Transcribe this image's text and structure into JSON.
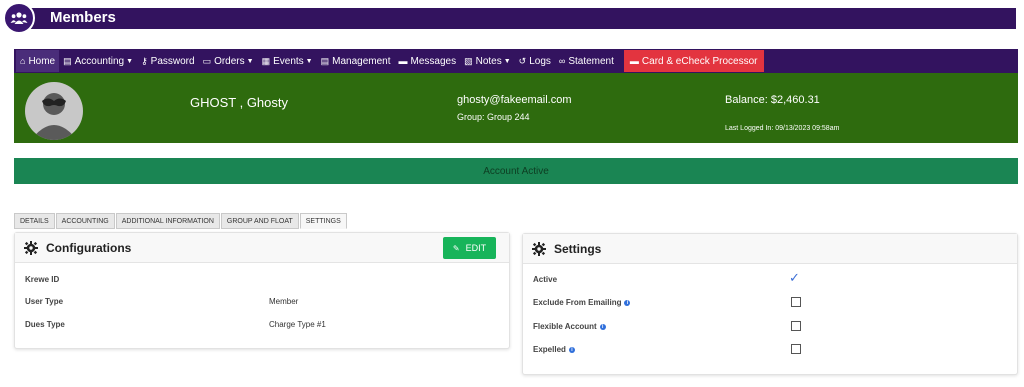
{
  "header": {
    "title": "Members",
    "logo_icon": "people-group-icon"
  },
  "nav": {
    "items": [
      {
        "label": "Home",
        "icon": "home-icon"
      },
      {
        "label": "Accounting",
        "icon": "ledger-icon"
      },
      {
        "label": "Password",
        "icon": "key-icon"
      },
      {
        "label": "Orders",
        "icon": "box-icon"
      },
      {
        "label": "Events",
        "icon": "calendar-icon"
      },
      {
        "label": "Management",
        "icon": "clipboard-icon"
      },
      {
        "label": "Messages",
        "icon": "chat-icon"
      },
      {
        "label": "Notes",
        "icon": "note-icon"
      },
      {
        "label": "Logs",
        "icon": "history-icon"
      },
      {
        "label": "Statement",
        "icon": "link-icon"
      },
      {
        "label": "Card & eCheck Processor",
        "icon": "credit-card-icon"
      }
    ]
  },
  "profile": {
    "name": "GHOST , Ghosty",
    "email": "ghosty@fakeemail.com",
    "group": "Group: Group 244",
    "balance": "Balance: $2,460.31",
    "last_logged": "Last Logged In: 09/13/2023 09:58am"
  },
  "status": {
    "text": "Account Active"
  },
  "tabs": [
    "DETAILS",
    "ACCOUNTING",
    "ADDITIONAL INFORMATION",
    "GROUP AND FLOAT",
    "SETTINGS"
  ],
  "configurations": {
    "title": "Configurations",
    "edit_label": "EDIT",
    "rows": [
      {
        "label": "Krewe ID",
        "value": ""
      },
      {
        "label": "User Type",
        "value": "Member"
      },
      {
        "label": "Dues Type",
        "value": "Charge Type #1"
      }
    ]
  },
  "settings": {
    "title": "Settings",
    "rows": [
      {
        "label": "Active",
        "checked": true
      },
      {
        "label": "Exclude From Emailing",
        "checked": false
      },
      {
        "label": "Flexible Account",
        "checked": false
      },
      {
        "label": "Expelled",
        "checked": false
      }
    ]
  },
  "colors": {
    "header_purple": "#33135f",
    "profile_green": "#2e6b0e",
    "status_green": "#1a8553",
    "processor_red": "#e3343f",
    "edit_green": "#17b45a"
  }
}
